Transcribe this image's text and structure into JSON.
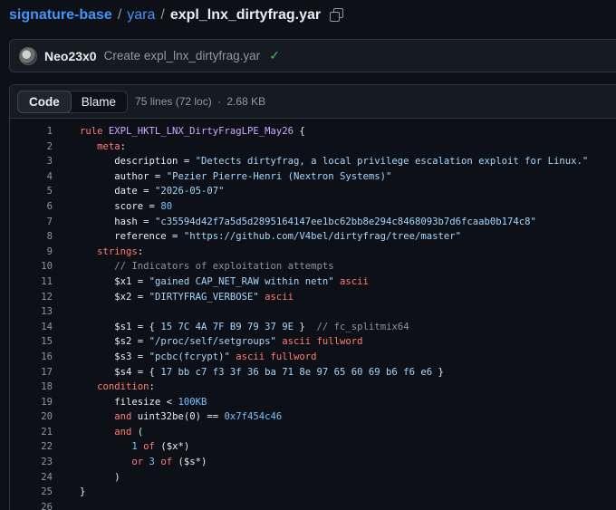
{
  "breadcrumb": {
    "repo": "signature-base",
    "dir": "yara",
    "file": "expl_lnx_dirtyfrag.yar",
    "separator": "/"
  },
  "commit": {
    "author": "Neo23x0",
    "message": "Create expl_lnx_dirtyfrag.yar",
    "status_icon": "check-icon"
  },
  "file_header": {
    "tabs": [
      {
        "label": "Code"
      },
      {
        "label": "Blame"
      }
    ],
    "lines_info": "75 lines (72 loc)",
    "dot": "·",
    "size": "2.68 KB"
  },
  "code_lines": [
    {
      "n": "1",
      "indent": "",
      "parts": [
        [
          "kw",
          "rule "
        ],
        [
          "fn",
          "EXPL_HKTL_LNX_DirtyFragLPE_May26"
        ],
        [
          "",
          "{"
        ]
      ]
    },
    {
      "n": "2",
      "indent": "   ",
      "parts": [
        [
          "kw",
          "meta"
        ],
        [
          "",
          ":"
        ]
      ]
    },
    {
      "n": "3",
      "indent": "      ",
      "parts": [
        [
          "",
          "description = "
        ],
        [
          "str",
          "\"Detects dirtyfrag, a local privilege escalation exploit for Linux.\""
        ]
      ]
    },
    {
      "n": "4",
      "indent": "      ",
      "parts": [
        [
          "",
          "author = "
        ],
        [
          "str",
          "\"Pezier Pierre-Henri (Nextron Systems)\""
        ]
      ]
    },
    {
      "n": "5",
      "indent": "      ",
      "parts": [
        [
          "",
          "date = "
        ],
        [
          "str",
          "\"2026-05-07\""
        ]
      ]
    },
    {
      "n": "6",
      "indent": "      ",
      "parts": [
        [
          "",
          "score = "
        ],
        [
          "num",
          "80"
        ]
      ]
    },
    {
      "n": "7",
      "indent": "      ",
      "parts": [
        [
          "",
          "hash = "
        ],
        [
          "str",
          "\"c35594d42f7a5d5d2895164147ee1bc62bb8e294c8468093b7d6fcaab0b174c8\""
        ]
      ]
    },
    {
      "n": "8",
      "indent": "      ",
      "parts": [
        [
          "",
          "reference = "
        ],
        [
          "str",
          "\"https://github.com/V4bel/dirtyfrag/tree/master\""
        ]
      ]
    },
    {
      "n": "9",
      "indent": "   ",
      "parts": [
        [
          "kw",
          "strings"
        ],
        [
          "",
          ":"
        ]
      ]
    },
    {
      "n": "10",
      "indent": "      ",
      "parts": [
        [
          "cmt",
          "// Indicators of exploitation attempts"
        ]
      ]
    },
    {
      "n": "11",
      "indent": "      ",
      "parts": [
        [
          "",
          "$x1 = "
        ],
        [
          "str",
          "\"gained CAP_NET_RAW within netn\""
        ],
        [
          "kw",
          " ascii"
        ]
      ]
    },
    {
      "n": "12",
      "indent": "      ",
      "parts": [
        [
          "",
          "$x2 = "
        ],
        [
          "str",
          "\"DIRTYFRAG_VERBOSE\""
        ],
        [
          "kw",
          " ascii"
        ]
      ]
    },
    {
      "n": "13",
      "indent": "",
      "parts": [
        [
          "",
          ""
        ]
      ]
    },
    {
      "n": "14",
      "indent": "      ",
      "parts": [
        [
          "",
          "$s1 = { "
        ],
        [
          "hex",
          "15 7C 4A 7F B9 79 37 9E"
        ],
        [
          "",
          " }  "
        ],
        [
          "cmt",
          "// fc_splitmix64"
        ]
      ]
    },
    {
      "n": "15",
      "indent": "      ",
      "parts": [
        [
          "",
          "$s2 = "
        ],
        [
          "str",
          "\"/proc/self/setgroups\""
        ],
        [
          "kw",
          " ascii fullword"
        ]
      ]
    },
    {
      "n": "16",
      "indent": "      ",
      "parts": [
        [
          "",
          "$s3 = "
        ],
        [
          "str",
          "\"pcbc(fcrypt)\""
        ],
        [
          "kw",
          " ascii fullword"
        ]
      ]
    },
    {
      "n": "17",
      "indent": "      ",
      "parts": [
        [
          "",
          "$s4 = { "
        ],
        [
          "hex",
          "17 bb c7 f3 3f 36 ba 71 8e 97 65 60 69 b6 f6 e6"
        ],
        [
          "",
          " }"
        ]
      ]
    },
    {
      "n": "18",
      "indent": "   ",
      "parts": [
        [
          "kw",
          "condition"
        ],
        [
          "",
          ":"
        ]
      ]
    },
    {
      "n": "19",
      "indent": "      ",
      "parts": [
        [
          "",
          "filesize < "
        ],
        [
          "num",
          "100KB"
        ]
      ]
    },
    {
      "n": "20",
      "indent": "      ",
      "parts": [
        [
          "kw",
          "and "
        ],
        [
          "",
          "uint32be(0) == "
        ],
        [
          "num",
          "0x7f454c46"
        ]
      ]
    },
    {
      "n": "21",
      "indent": "      ",
      "parts": [
        [
          "kw",
          "and"
        ],
        [
          "",
          " ("
        ]
      ]
    },
    {
      "n": "22",
      "indent": "         ",
      "parts": [
        [
          "num",
          "1"
        ],
        [
          "kw",
          " of"
        ],
        [
          "",
          " ($x*)"
        ]
      ]
    },
    {
      "n": "23",
      "indent": "         ",
      "parts": [
        [
          "kw",
          "or "
        ],
        [
          "num",
          "3"
        ],
        [
          "kw",
          " of"
        ],
        [
          "",
          " ($s*)"
        ]
      ]
    },
    {
      "n": "24",
      "indent": "      ",
      "parts": [
        [
          "",
          ")"
        ]
      ]
    },
    {
      "n": "25",
      "indent": "",
      "parts": [
        [
          "",
          "}"
        ]
      ]
    },
    {
      "n": "26",
      "indent": "",
      "parts": [
        [
          "",
          ""
        ]
      ]
    }
  ]
}
